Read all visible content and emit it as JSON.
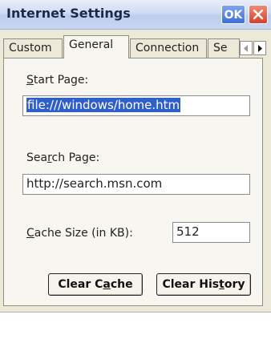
{
  "window": {
    "title": "Internet Settings",
    "ok_label": "OK",
    "close_icon": "close-icon"
  },
  "tabs": [
    {
      "label": "Custom",
      "active": false
    },
    {
      "label": "General",
      "active": true
    },
    {
      "label": "Connection",
      "active": false
    },
    {
      "label": "Se",
      "active": false
    }
  ],
  "start_page": {
    "label_pre": "",
    "label_key": "S",
    "label_post": "tart Page:",
    "value": "file:///windows/home.htm"
  },
  "search_page": {
    "label_pre": "Sea",
    "label_key": "r",
    "label_post": "ch Page:",
    "value": "http://search.msn.com"
  },
  "cache": {
    "label_pre": "",
    "label_key": "C",
    "label_post": "ache Size (in KB):",
    "value": "512"
  },
  "buttons": {
    "clear_cache": {
      "pre": "Clear C",
      "key": "a",
      "post": "che"
    },
    "clear_history": {
      "pre": "Clear His",
      "key": "t",
      "post": "ory"
    }
  }
}
